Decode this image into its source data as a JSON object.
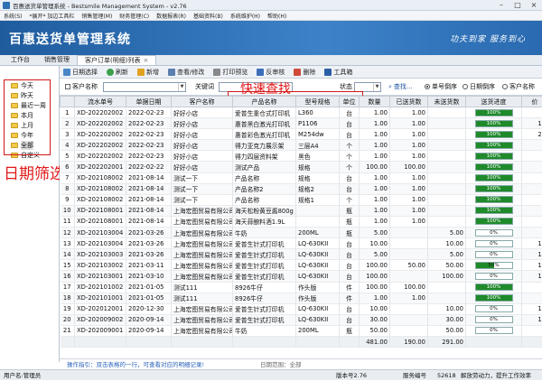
{
  "window": {
    "title": "百惠送货单管理系统 - Bestsmile Management System - v2.76"
  },
  "menu": [
    "系统(S)",
    "*展开* 加边工具栏",
    "销售管理(M)",
    "财务管理(C)",
    "数据报表(R)",
    "基础资料(B)",
    "系统维护(H)",
    "帮助(H)"
  ],
  "banner": {
    "title": "百惠送货单管理系统",
    "slogan": "功夫到家  服务到心"
  },
  "tabs": [
    {
      "label": "工作台"
    },
    {
      "label": "销售管理"
    },
    {
      "label": "客户订单(明细)列表",
      "close": "×"
    }
  ],
  "tree": {
    "root": "全部",
    "items": [
      "今天",
      "昨天",
      "最近一周",
      "本月",
      "上月",
      "今年",
      "全部",
      "自定义"
    ]
  },
  "annotations": {
    "date_filter": "日期筛选",
    "quick_search": "快速查找"
  },
  "toolbar": [
    "日期选择",
    "刷新",
    "新增",
    "查看/修改",
    "打印预览",
    "反审核",
    "删除",
    "工具箱"
  ],
  "filter": {
    "customer_label": "客户名称",
    "keyword_label": "关键词",
    "status_label": "状态",
    "search_label": "查找...",
    "sort_options": [
      "单号倒序",
      "日期倒序",
      "客户名称"
    ]
  },
  "columns": [
    "",
    "流水单号",
    "单据日期",
    "客户名称",
    "产品名称",
    "型号规格",
    "单位",
    "数量",
    "已送货数",
    "未送货数",
    "送货进度",
    "价"
  ],
  "rows": [
    [
      "1",
      "XD-202202002",
      "2022-02-23",
      "好好小店",
      "爱普生重仓式打印机",
      "L360",
      "台",
      "1.00",
      "1.00",
      "",
      100,
      "2"
    ],
    [
      "2",
      "XD-202202002",
      "2022-02-23",
      "好好小店",
      "惠普黑白激光打印机",
      "P1106",
      "台",
      "1.00",
      "1.00",
      "",
      100,
      "16"
    ],
    [
      "3",
      "XD-202202002",
      "2022-02-23",
      "好好小店",
      "惠普彩色激光打印机",
      "M254dw",
      "台",
      "1.00",
      "1.00",
      "",
      100,
      "28"
    ],
    [
      "4",
      "XD-202202002",
      "2022-02-23",
      "好好小店",
      "得力亚克力展示架",
      "三层A4",
      "个",
      "1.00",
      "1.00",
      "",
      100,
      ""
    ],
    [
      "5",
      "XD-202202002",
      "2022-02-23",
      "好好小店",
      "得力四层资料架",
      "黑色",
      "个",
      "1.00",
      "1.00",
      "",
      100,
      ""
    ],
    [
      "6",
      "XD-202202001",
      "2022-02-22",
      "好好小店",
      "测试产品",
      "规格",
      "个",
      "100.00",
      "100.00",
      "",
      100,
      ""
    ],
    [
      "7",
      "XD-202108002",
      "2021-08-14",
      "测试一下",
      "产品名称",
      "规格",
      "台",
      "1.00",
      "1.00",
      "",
      100,
      "1"
    ],
    [
      "8",
      "XD-202108002",
      "2021-08-14",
      "测试一下",
      "产品名称2",
      "规格2",
      "台",
      "1.00",
      "1.00",
      "",
      100,
      "2"
    ],
    [
      "9",
      "XD-202108002",
      "2021-08-14",
      "测试一下",
      "产品名称",
      "规格1",
      "个",
      "1.00",
      "1.00",
      "",
      100,
      "1"
    ],
    [
      "10",
      "XD-202108001",
      "2021-08-14",
      "上海宏图贸易有限公司",
      "海天松粉黄豆酱800g",
      "",
      "瓶",
      "1.00",
      "1.00",
      "",
      100,
      ""
    ],
    [
      "11",
      "XD-202108001",
      "2021-08-14",
      "上海宏图贸易有限公司",
      "海天蒜酿料酒1.9L",
      "",
      "瓶",
      "1.00",
      "1.00",
      "",
      100,
      ""
    ],
    [
      "12",
      "XD-202103004",
      "2021-03-26",
      "上海宏图贸易有限公司",
      "牛奶",
      "200ML",
      "瓶",
      "5.00",
      "",
      "5.00",
      0,
      ""
    ],
    [
      "13",
      "XD-202103004",
      "2021-03-26",
      "上海宏图贸易有限公司",
      "爱普生针式打印机",
      "LQ-630KII",
      "台",
      "10.00",
      "",
      "10.00",
      0,
      "15"
    ],
    [
      "14",
      "XD-202103003",
      "2021-03-26",
      "上海宏图贸易有限公司",
      "爱普生针式打印机",
      "LQ-630KII",
      "台",
      "5.00",
      "",
      "5.00",
      0,
      "15"
    ],
    [
      "15",
      "XD-202103002",
      "2021-03-11",
      "上海宏图贸易有限公司",
      "爱普生针式打印机",
      "LQ-630KII",
      "台",
      "100.00",
      "50.00",
      "50.00",
      50,
      "15"
    ],
    [
      "16",
      "XD-202103001",
      "2021-03-10",
      "上海宏图贸易有限公司",
      "爱普生针式打印机",
      "LQ-630KII",
      "台",
      "100.00",
      "",
      "100.00",
      0,
      "15"
    ],
    [
      "17",
      "XD-202101002",
      "2021-01-05",
      "测试111",
      "8926牛仔",
      "作头版",
      "件",
      "100.00",
      "100.00",
      "",
      100,
      ""
    ],
    [
      "18",
      "XD-202101001",
      "2021-01-05",
      "测试111",
      "8926牛仔",
      "作头版",
      "件",
      "1.00",
      "1.00",
      "",
      100,
      ""
    ],
    [
      "19",
      "XD-202012001",
      "2020-12-30",
      "上海宏图贸易有限公司",
      "爱普生针式打印机",
      "LQ-630KII",
      "台",
      "10.00",
      "",
      "10.00",
      0,
      "15"
    ],
    [
      "20",
      "XD-202009002",
      "2020-09-14",
      "上海宏图贸易有限公司",
      "爱普生针式打印机",
      "LQ-630KII",
      "台",
      "30.00",
      "",
      "30.00",
      0,
      "15"
    ],
    [
      "21",
      "XD-202009001",
      "2020-09-14",
      "上海宏图贸易有限公司",
      "牛奶",
      "200ML",
      "瓶",
      "50.00",
      "",
      "50.00",
      0,
      ""
    ]
  ],
  "summary": {
    "qty": "481.00",
    "delivered": "190.00",
    "undelivered": "291.00"
  },
  "hint": {
    "left": "操作指引：双击表格的一行，可查看对应的明细记录!",
    "right": "日期范围：全部"
  },
  "status": {
    "user": "用户名:管理员",
    "version": "版本号2.76",
    "service": "服务编号",
    "id": "52618",
    "slogan": "解放劳动力，提升工作效率"
  }
}
